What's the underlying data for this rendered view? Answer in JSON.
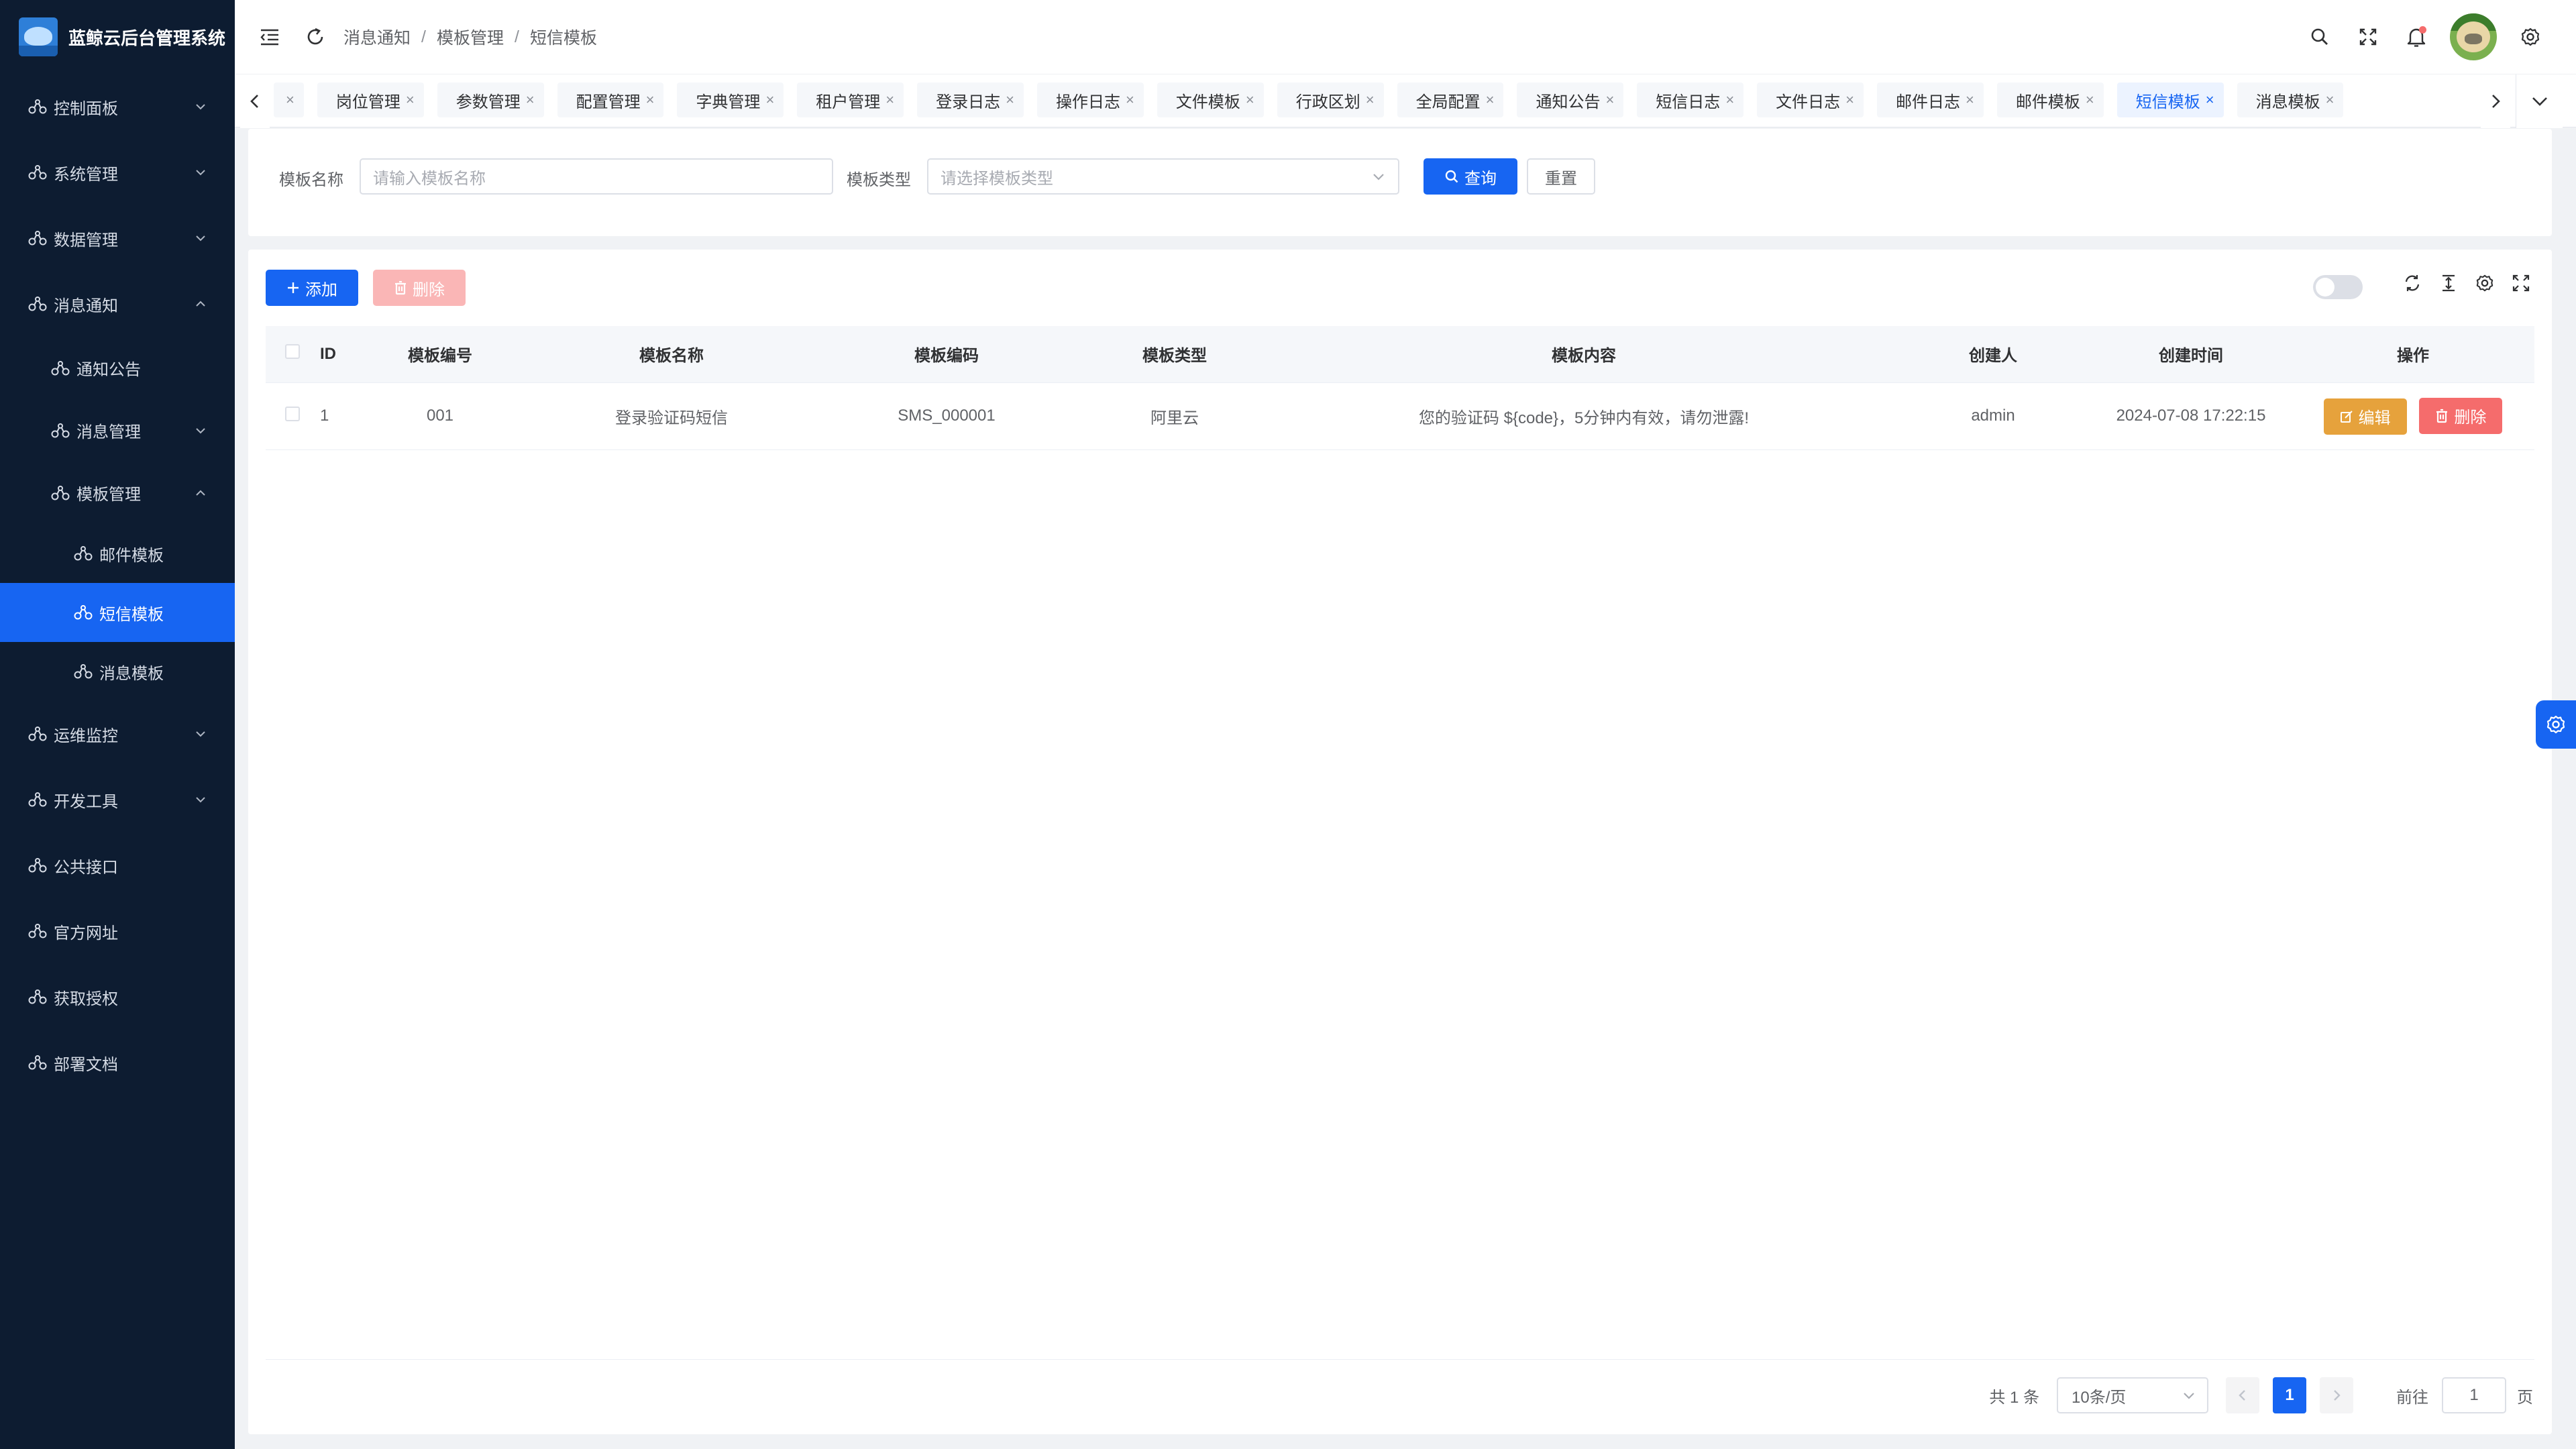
{
  "app": {
    "title": "蓝鲸云后台管理系统"
  },
  "sidebar": {
    "items": [
      {
        "label": "控制面板",
        "level": 1,
        "chevron": "down"
      },
      {
        "label": "系统管理",
        "level": 1,
        "chevron": "down"
      },
      {
        "label": "数据管理",
        "level": 1,
        "chevron": "down"
      },
      {
        "label": "消息通知",
        "level": 1,
        "chevron": "up"
      },
      {
        "label": "通知公告",
        "level": 2,
        "chevron": ""
      },
      {
        "label": "消息管理",
        "level": 2,
        "chevron": "down"
      },
      {
        "label": "模板管理",
        "level": 2,
        "chevron": "up"
      },
      {
        "label": "邮件模板",
        "level": 3,
        "chevron": ""
      },
      {
        "label": "短信模板",
        "level": 3,
        "chevron": "",
        "active": true
      },
      {
        "label": "消息模板",
        "level": 3,
        "chevron": ""
      },
      {
        "label": "运维监控",
        "level": 1,
        "chevron": "down"
      },
      {
        "label": "开发工具",
        "level": 1,
        "chevron": "down"
      },
      {
        "label": "公共接口",
        "level": 1,
        "chevron": ""
      },
      {
        "label": "官方网址",
        "level": 1,
        "chevron": ""
      },
      {
        "label": "获取授权",
        "level": 1,
        "chevron": ""
      },
      {
        "label": "部署文档",
        "level": 1,
        "chevron": ""
      }
    ]
  },
  "breadcrumb": {
    "items": [
      "消息通知",
      "模板管理",
      "短信模板"
    ],
    "separator": "/"
  },
  "tabs": [
    {
      "label": "",
      "partial": true
    },
    {
      "label": "岗位管理"
    },
    {
      "label": "参数管理"
    },
    {
      "label": "配置管理"
    },
    {
      "label": "字典管理"
    },
    {
      "label": "租户管理"
    },
    {
      "label": "登录日志"
    },
    {
      "label": "操作日志"
    },
    {
      "label": "文件模板"
    },
    {
      "label": "行政区划"
    },
    {
      "label": "全局配置"
    },
    {
      "label": "通知公告"
    },
    {
      "label": "短信日志"
    },
    {
      "label": "文件日志"
    },
    {
      "label": "邮件日志"
    },
    {
      "label": "邮件模板"
    },
    {
      "label": "短信模板",
      "active": true
    },
    {
      "label": "消息模板"
    }
  ],
  "search": {
    "name_label": "模板名称",
    "name_placeholder": "请输入模板名称",
    "type_label": "模板类型",
    "type_placeholder": "请选择模板类型",
    "query_label": "查询",
    "reset_label": "重置"
  },
  "toolbar": {
    "add_label": "添加",
    "delete_label": "删除"
  },
  "table": {
    "headers": {
      "id": "ID",
      "no": "模板编号",
      "name": "模板名称",
      "code": "模板编码",
      "type": "模板类型",
      "content": "模板内容",
      "creator": "创建人",
      "created": "创建时间",
      "ops": "操作"
    },
    "rows": [
      {
        "id": "1",
        "no": "001",
        "name": "登录验证码短信",
        "code": "SMS_000001",
        "type": "阿里云",
        "content": "您的验证码 ${code}，5分钟内有效，请勿泄露!",
        "creator": "admin",
        "created": "2024-07-08 17:22:15",
        "edit": "编辑",
        "delete": "删除"
      }
    ]
  },
  "pagination": {
    "total_text": "共 1 条",
    "page_size": "10条/页",
    "current_page": "1",
    "goto_label": "前往",
    "goto_value": "1",
    "page_suffix": "页"
  },
  "colors": {
    "primary": "#1765f2",
    "sidebar_bg": "#0d1c31",
    "warning": "#e6a23c",
    "danger": "#f56c6c"
  }
}
